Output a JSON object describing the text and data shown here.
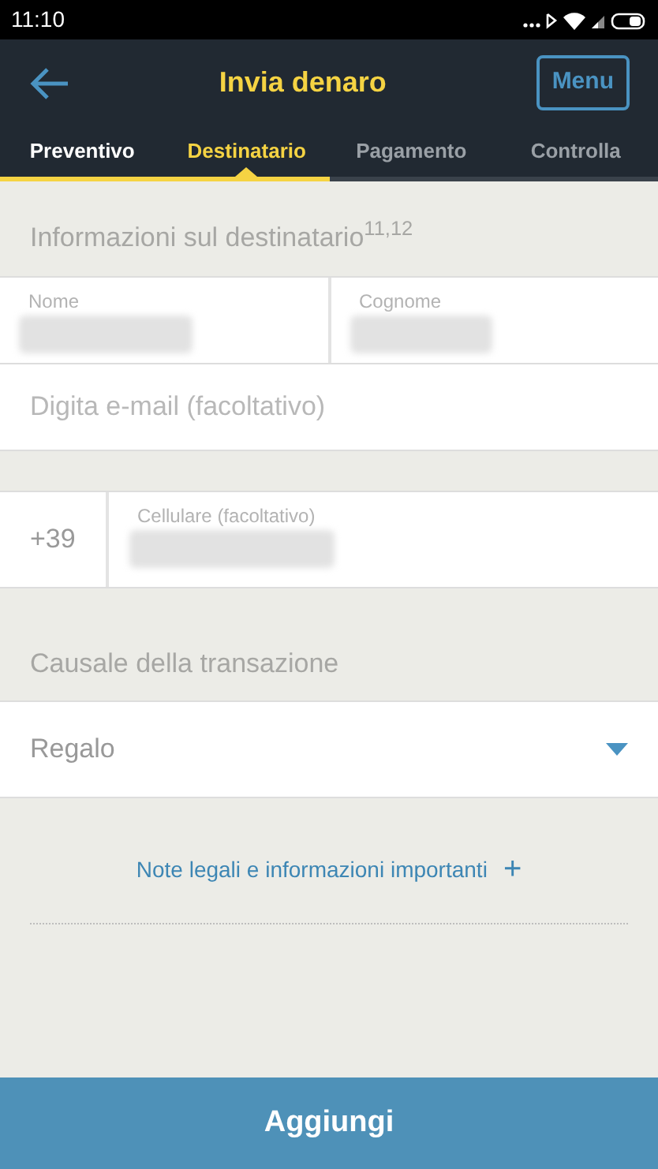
{
  "status_bar": {
    "time": "11:10"
  },
  "header": {
    "title": "Invia denaro",
    "menu_button": "Menu"
  },
  "tabs": [
    {
      "label": "Preventivo",
      "selected": false
    },
    {
      "label": "Destinatario",
      "selected": true
    },
    {
      "label": "Pagamento",
      "selected": false
    },
    {
      "label": "Controlla",
      "selected": false
    }
  ],
  "recipient_section": {
    "title": "Informazioni sul destinatario$^{11,12}$"
  },
  "name_fields": [
    {
      "label": "Nome"
    },
    {
      "label": "Cognome"
    }
  ],
  "email_field": {
    "placeholder": "Digita e-mail (facoltativo)"
  },
  "phone": {
    "prefix": "+39",
    "label": "Cellulare (facoltativo)"
  },
  "purpose_section": {
    "title": "Causale della transazione"
  },
  "purpose_select": {
    "value": "Regalo"
  },
  "legal_link": {
    "label": "Note legali e informazioni importanti",
    "icon": "+"
  },
  "add_button": "Aggiungi"
}
